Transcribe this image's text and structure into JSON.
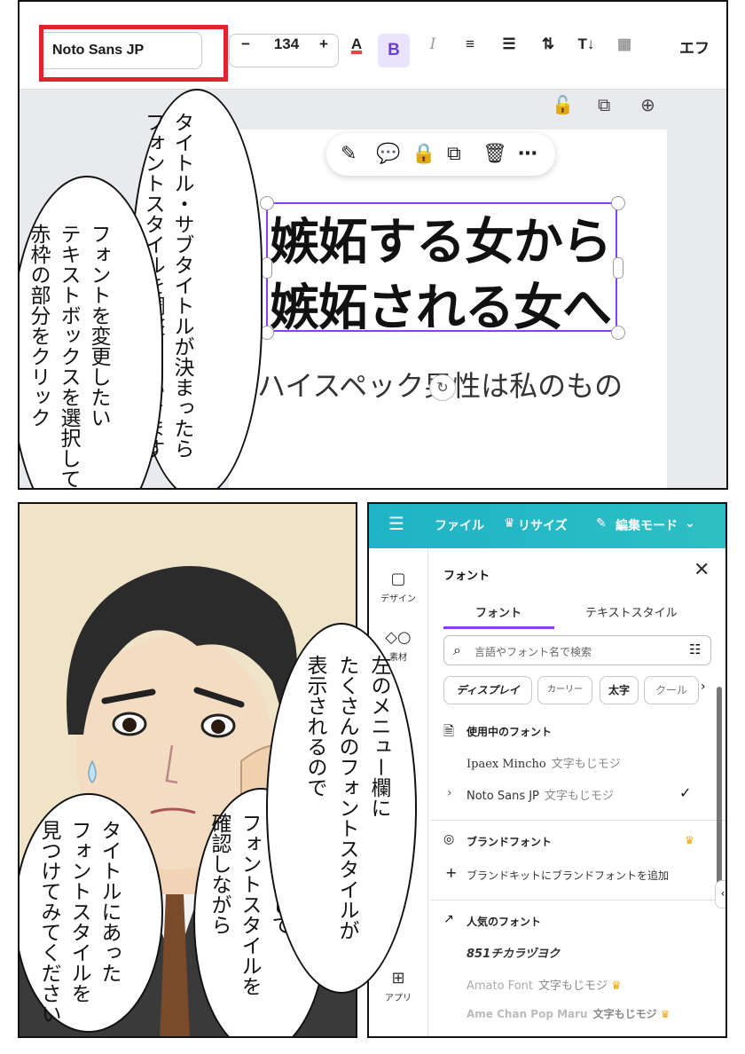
{
  "toolbar": {
    "font_name": "Noto Sans JP",
    "minus": "−",
    "font_size": "134",
    "plus": "+",
    "color_letter": "A",
    "bold": "B",
    "italic": "I",
    "more_label": "エフ"
  },
  "canvas": {
    "title_line1": "嫉妬する女から",
    "title_line2": "嫉妬される女へ",
    "subtitle": "ハイスペック男性は私のもの"
  },
  "bubbles": {
    "top_right": [
      "タイトル・サブタイトルが決まったら",
      "フォントスタイルを調整していきます"
    ],
    "top_left": [
      "フォントを変更したい",
      "テキストボックスを選択して",
      "赤枠の部分をクリック"
    ],
    "bottom_right": [
      "左のメニュー欄に",
      "たくさんのフォントスタイルが",
      "表示されるので"
    ],
    "bottom_mid": [
      "クリックして",
      "フォントスタイルを",
      "確認しながら"
    ],
    "bottom_left": [
      "タイトルにあった",
      "フォントスタイルを",
      "見つけてみてください"
    ]
  },
  "canva": {
    "header": {
      "menu_icon": "hamburger-icon",
      "file": "ファイル",
      "resize": "リサイズ",
      "edit_mode": "編集モード"
    },
    "side_nav": [
      {
        "icon": "design-icon",
        "label": "デザイン"
      },
      {
        "icon": "elements-icon",
        "label": "素材"
      },
      {
        "icon": "apps-icon",
        "label": "アプリ"
      }
    ],
    "font_panel": {
      "title": "フォント",
      "tabs": [
        "フォント",
        "テキストスタイル"
      ],
      "search_placeholder": "言語やフォント名で検索",
      "chips": [
        "ディスプレイ",
        "カーリー",
        "太字",
        "クール"
      ],
      "in_use_header": "使用中のフォント",
      "in_use": [
        {
          "name": "Ipaex Mincho",
          "sample": "文字もじモジ"
        },
        {
          "name": "Noto Sans JP",
          "sample": "文字もじモジ",
          "selected": true
        }
      ],
      "brand_header": "ブランドフォント",
      "brand_add": "ブランドキットにブランドフォントを追加",
      "popular_header": "人気のフォント",
      "popular": [
        {
          "name": "851チカラヅヨク",
          "sample": ""
        },
        {
          "name": "Amato Font",
          "sample": "文字もじモジ",
          "premium": true
        },
        {
          "name": "Ame Chan Pop Maru",
          "sample": "文字もじモジ",
          "premium": true
        }
      ]
    }
  },
  "colors": {
    "highlight_red": "#e0242d",
    "selection_purple": "#8b3dff",
    "canva_teal": "#1fb3c7"
  }
}
